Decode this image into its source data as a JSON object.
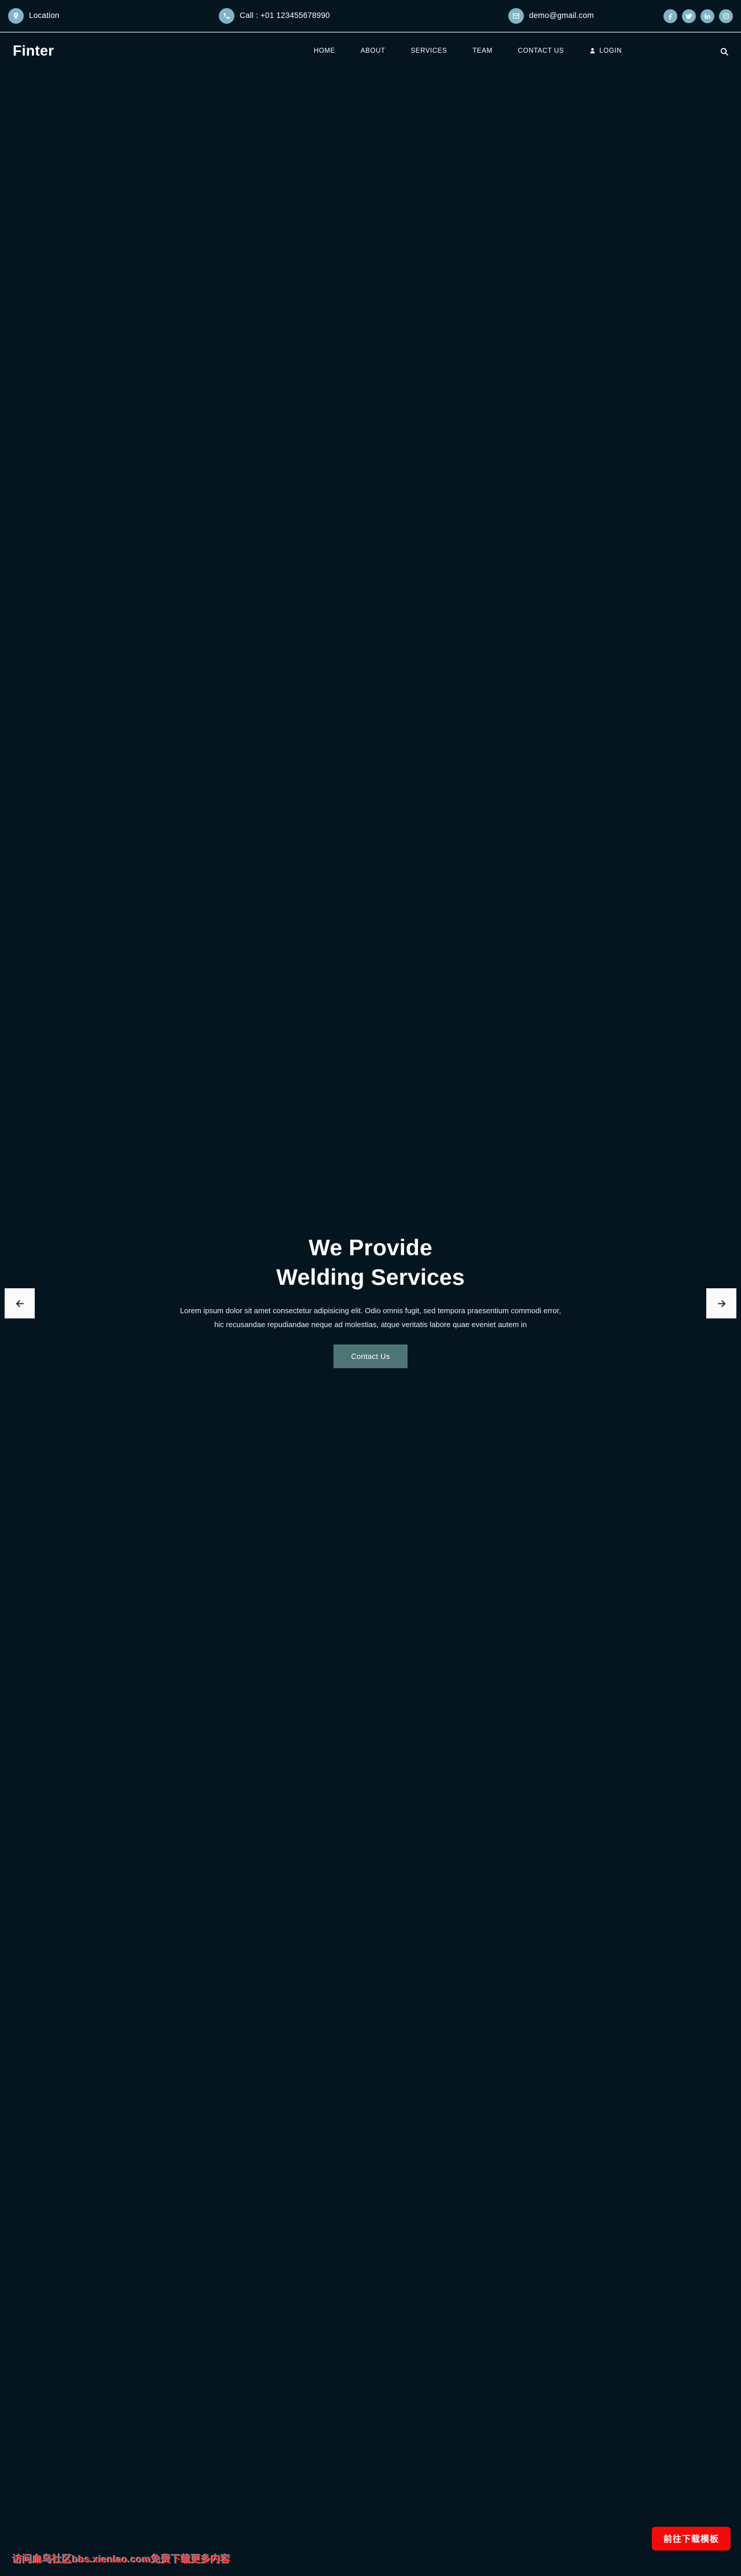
{
  "colors": {
    "background": "#041520",
    "accent_circle": "#7fb5c6",
    "cta_button": "#4d7574",
    "download_button": "#f20b0b",
    "watermark_text": "#e8332e",
    "text": "#ffffff",
    "arrow_button_bg": "#fbfbfb"
  },
  "topbar": {
    "location": {
      "icon": "map-pin-icon",
      "label": "Location"
    },
    "call": {
      "icon": "phone-icon",
      "label": "Call : +01 123455678990"
    },
    "email": {
      "icon": "envelope-icon",
      "label": "demo@gmail.com"
    },
    "socials": [
      {
        "icon": "facebook-icon",
        "name": "Facebook"
      },
      {
        "icon": "twitter-icon",
        "name": "Twitter"
      },
      {
        "icon": "linkedin-icon",
        "name": "LinkedIn"
      },
      {
        "icon": "instagram-icon",
        "name": "Instagram"
      }
    ]
  },
  "nav": {
    "logo": "Finter",
    "links": [
      {
        "label": "HOME"
      },
      {
        "label": "ABOUT"
      },
      {
        "label": "SERVICES"
      },
      {
        "label": "TEAM"
      },
      {
        "label": "CONTACT US"
      }
    ],
    "login": {
      "icon": "user-icon",
      "label": "LOGIN"
    },
    "search": {
      "icon": "search-icon"
    }
  },
  "hero": {
    "title_line1": "We Provide",
    "title_line2": "Welding Services",
    "description": "Lorem ipsum dolor sit amet consectetur adipisicing elit. Odio omnis fugit, sed tempora praesentium commodi error, hic recusandae repudiandae neque ad molestias, atque veritatis labore quae eveniet autem in",
    "cta_label": "Contact Us",
    "prev_arrow": {
      "icon": "arrow-left-icon"
    },
    "next_arrow": {
      "icon": "arrow-right-icon"
    }
  },
  "overlay": {
    "watermark": "访问血鸟社区bbs.xienlao.com免费下载更多内容",
    "download_label": "前往下载模板"
  }
}
